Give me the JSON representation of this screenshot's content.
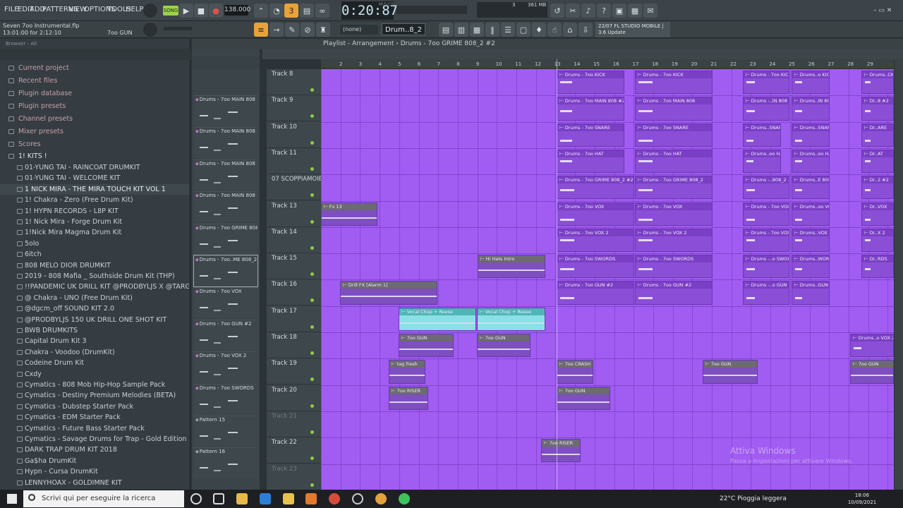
{
  "menu": [
    "FILE",
    "EDIT",
    "ADD",
    "PATTERNS",
    "VIEW",
    "OPTIONS",
    "TOOLS",
    "HELP"
  ],
  "transport": {
    "mode": "SONG",
    "tempo": "138.000",
    "time": "0:20:87",
    "time_unit": "M:S:CS",
    "memory": "361 MB",
    "cpu_value": "3",
    "cpu_sub": "1"
  },
  "hint": {
    "project": "Seven 7oo Instrumental.flp",
    "position": "13:01:00 for 2:12:10",
    "channel": "7oo GUN"
  },
  "pattern_selector": {
    "none_label": "(none)",
    "selected": "Drum..8_2 #2"
  },
  "news": {
    "line1": "22/07  FL STUDIO MOBILE |",
    "line2": "3.6 Update"
  },
  "browser": {
    "header": "Browser - All",
    "root_items": [
      "Current project",
      "Recent files",
      "Plugin database",
      "Plugin presets",
      "Channel presets",
      "Mixer presets",
      "Scores"
    ],
    "folder": "1! KITS !",
    "kits": [
      "01-YUNG TAI - RAINCOAT DRUMKIT",
      "01-YUNG TAI - WELCOME KIT",
      "1 NICK MIRA - THE MIRA TOUCH KIT VOL 1",
      "1! Chakra - Zero (Free Drum Kit)",
      "1! HYPN RECORDS - L8P KIT",
      "1! Nick Mira - Forge Drum Kit",
      "1!Nick Mira Magma Drum Kit",
      "5olo",
      "6itch",
      "808 MELO DIOR DRUMKIT",
      "2019 - 808 Mafia _ Southside Drum Kit (THP)",
      "!!PANDEMIC UK DRILL KIT @PRODBYLJS X @TARGETT",
      "@ Chakra - UNO (Free Drum Kit)",
      "@dgcm_off SOUND KIT 2.0",
      "@PRODBYLJS 150 UK DRILL ONE SHOT KIT",
      "BWB DRUMKITS",
      "Capital Drum Kit 3",
      "Chakra - Voodoo (DrumKit)",
      "Codeine Drum Kit",
      "Cxdy",
      "Cymatics - 808 Mob Hip-Hop Sample Pack",
      "Cymatics - Destiny Premium Melodies (BETA)",
      "Cymatics - Dubstep Starter Pack",
      "Cymatics - EDM Starter Pack",
      "Cymatics - Future Bass Starter Pack",
      "Cymatics - Savage Drums for Trap - Gold Edition",
      "DARK TRAP DRUM KIT 2018",
      "Ga$ha DrumKit",
      "Hypn - Cursa DrumKit",
      "LENNYHOAX - GOLDIMNE KIT"
    ]
  },
  "picker": [
    "Drums - 7oo MAIN 808",
    "Drums - 7oo MAIN 808 #3",
    "Drums - 7oo MAIN 808 #2",
    "Drums - 7oo MAIN 808 #4",
    "Drums - 7oo GRIME 808_2",
    "Drums - 7oo..ME 808_2 #2",
    "Drums - 7oo VOX",
    "Drums - 7oo GUN #2",
    "Drums - 7oo VOX 2",
    "Drums - 7oo SWORDS",
    "Pattern 15",
    "Pattern 16"
  ],
  "playlist": {
    "title": "Playlist - Arrangement",
    "pattern": "Drums - 7oo GRIME 808_2 #2",
    "ruler": [
      "2",
      "3",
      "4",
      "5",
      "6",
      "7",
      "8",
      "9",
      "10",
      "11",
      "12",
      "13",
      "14",
      "15",
      "16",
      "17",
      "18",
      "19",
      "20",
      "21",
      "22",
      "23",
      "24",
      "25",
      "26",
      "27",
      "28",
      "29"
    ],
    "tracks": [
      "Track 8",
      "Track 9",
      "Track 10",
      "Track 11",
      "07 SCOPPIAMOIBBOTTI",
      "Track 13",
      "Track 14",
      "Track 15",
      "Track 16",
      "Track 17",
      "Track 18",
      "Track 19",
      "Track 20",
      "Track 21",
      "Track 22",
      "Track 23"
    ],
    "clips": {
      "kick": "Drums - 7oo KICK",
      "kick_s": "Drums..o KICK",
      "kick_t": "Drums - 7oo KICK",
      "main": "Drums - 7oo MAIN 808 #2",
      "main2": "Drums - 7oo MAIN 808",
      "main_s": "Drums -..IN 808 #2",
      "main_t": "Drums..IN 808",
      "snare": "Drums - 7oo SNARE",
      "snare_s": "Drums..SNARE",
      "hat": "Drums - 7oo HAT",
      "hat_s": "Drums..oo HAT",
      "grime": "Drums - 7oo GRIME 808_2 #2",
      "grime2": "Drums - 7oo GRIME 808_2",
      "grime_s": "Drums -..808_2 #2",
      "grime_t": "Drums..E 808_2",
      "vox": "Drums - 7oo VOX",
      "vox_s": "Drums..oo VOX",
      "vox2": "Drums - 7oo VOX 2",
      "vox2_s": "Drums..VOX 2",
      "swords": "Drums - 7oo SWORDS",
      "swords_s": "Drums -..o SWORDS",
      "swords_t": "Drums..WORDS",
      "gun2": "Drums - 7oo GUN #2",
      "gun2_s": "Drums -..o GUN #2",
      "gun2_t": "Drums..GUN #2",
      "fx13": "Fx 13",
      "hihats": "Hi Hats Intro",
      "drillfx": "Drill FX [Alarm 1]",
      "vocal": "Vocal Chop + Reese",
      "gun": "7oo GUN",
      "tag": "tag fresh",
      "crash": "7oo CRASH",
      "riser": "7oo RISER",
      "vox2_end": "Drums..o VOX 2",
      "edge_kick": "Drums..CK",
      "edge_main": "Dr..8 #2",
      "edge_sn": "Dr..ARE",
      "edge_hat": "Dr..AT",
      "edge_gr": "Dr..2 #2",
      "edge_vox": "Dr..VOX",
      "edge_vox2": "Dr..X 2",
      "edge_sw": "Dr..RDS"
    }
  },
  "watermark": {
    "title": "Attiva Windows",
    "subtitle": "Passa a Impostazioni per attivare Windows."
  },
  "taskbar": {
    "search_placeholder": "Scrivi qui per eseguire la ricerca",
    "weather": "22°C  Pioggia leggera",
    "time": "18:06",
    "date": "10/09/2021"
  },
  "colors": {
    "playlist_bg": "#a15cf2",
    "clip": "#8a4fd6",
    "accent": "#9bd24a"
  }
}
